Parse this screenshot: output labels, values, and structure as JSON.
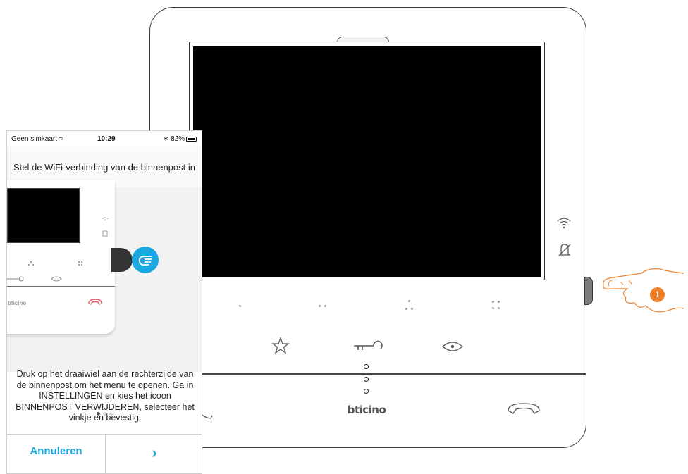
{
  "phone": {
    "status": {
      "carrier": "Geen simkaart",
      "time": "10:29",
      "battery": "82%",
      "battery_level": 0.82
    },
    "title": "Stel de WiFi-verbinding van de binnenpost in",
    "pagination": {
      "current": 1,
      "total": 3
    },
    "instructions": "Druk op het draaiwiel aan de rechterzijde van de binnenpost om het menu te openen. Ga in INSTELLINGEN en kies het icoon BINNENPOST VERWIJDEREN, selecteer het vinkje en bevestig.",
    "cancel_label": "Annuleren",
    "next_label": "›"
  },
  "device": {
    "brand": "bticino",
    "callout_number": "1",
    "icons": [
      "wifi-icon",
      "bell-off-icon",
      "star-icon",
      "key-icon",
      "eye-icon",
      "hang-up-icon",
      "answer-icon"
    ]
  },
  "colors": {
    "accent": "#1ba8e0",
    "callout": "#f0812b",
    "hangup_red": "#e0484f"
  }
}
